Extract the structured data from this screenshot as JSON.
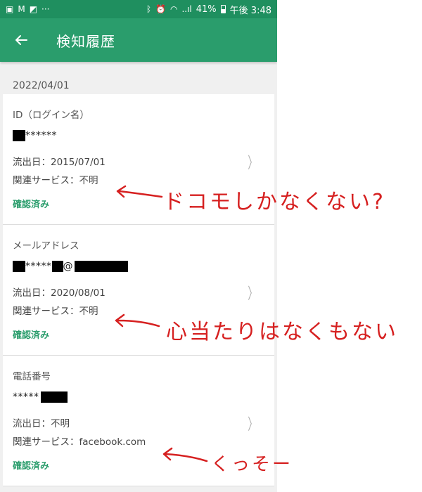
{
  "status_bar": {
    "battery": "41%",
    "time": "午後 3:48",
    "signal": "..ıl"
  },
  "app_bar": {
    "title": "検知履歴"
  },
  "date": "2022/04/01",
  "records": [
    {
      "label": "ID（ログイン名）",
      "masked_text": "******",
      "leaked_date": "流出日：2015/07/01",
      "service": "関連サービス：不明",
      "status": "確認済み"
    },
    {
      "label": "メールアドレス",
      "masked_text_a": "*****",
      "at": "@",
      "leaked_date": "流出日：2020/08/01",
      "service": "関連サービス：不明",
      "status": "確認済み"
    },
    {
      "label": "電話番号",
      "masked_text": "*****",
      "leaked_date": "流出日：不明",
      "service": "関連サービス：facebook.com",
      "status": "確認済み"
    }
  ],
  "annotations": {
    "note1": "ドコモしかなくない?",
    "note2": "心当たりはなくもない",
    "note3": "くっそー"
  },
  "colors": {
    "status_bar": "#1f8f5f",
    "app_bar": "#2a9d6c",
    "accent_text": "#2a9d6c",
    "annotation": "#d62020",
    "background": "#f0f0f0"
  }
}
